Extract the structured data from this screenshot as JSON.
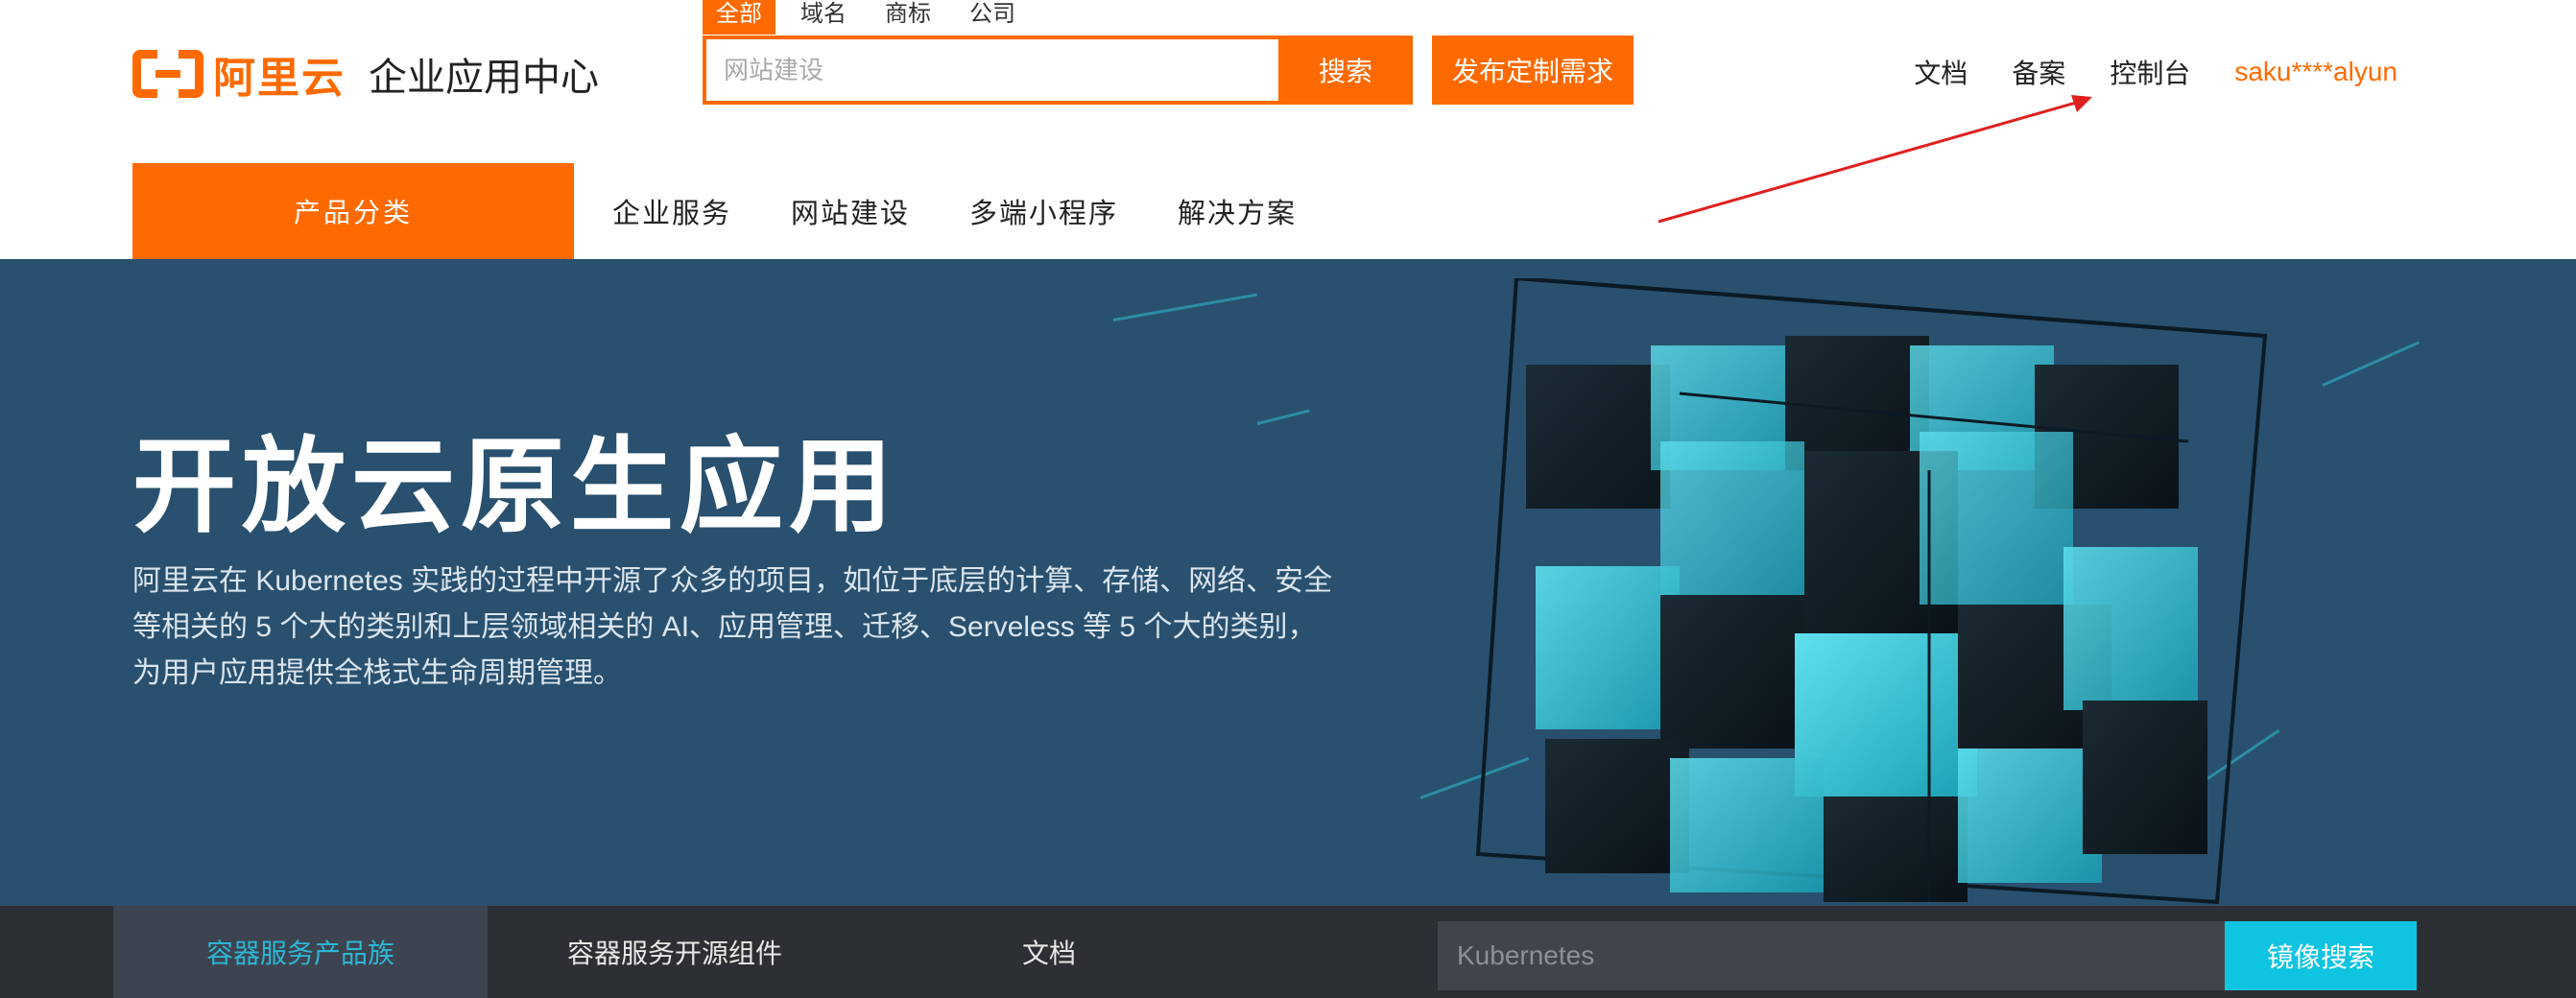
{
  "brand": {
    "logo_text": "阿里云",
    "subtitle": "企业应用中心",
    "color": "#ff6a00"
  },
  "search": {
    "tabs": [
      "全部",
      "域名",
      "商标",
      "公司"
    ],
    "placeholder": "网站建设",
    "button": "搜索"
  },
  "publish_button": "发布定制需求",
  "top_links": {
    "docs": "文档",
    "record": "备案",
    "console": "控制台",
    "user": "saku****alyun"
  },
  "nav": {
    "category": "产品分类",
    "items": [
      "企业服务",
      "网站建设",
      "多端小程序",
      "解决方案"
    ]
  },
  "hero": {
    "title": "开放云原生应用",
    "desc_lines": [
      "阿里云在 Kubernetes 实践的过程中开源了众多的项目，如位于底层的计算、存储、网络、安全",
      "等相关的 5 个大的类别和上层领域相关的 AI、应用管理、迁移、Serveless 等 5 个大的类别，",
      "为用户应用提供全栈式生命周期管理。"
    ],
    "background": "#29506e"
  },
  "subbar": {
    "tabs": [
      "容器服务产品族",
      "容器服务开源组件",
      "文档"
    ],
    "input_placeholder": "Kubernetes",
    "button": "镜像搜索",
    "accent": "#0ec4e0"
  }
}
